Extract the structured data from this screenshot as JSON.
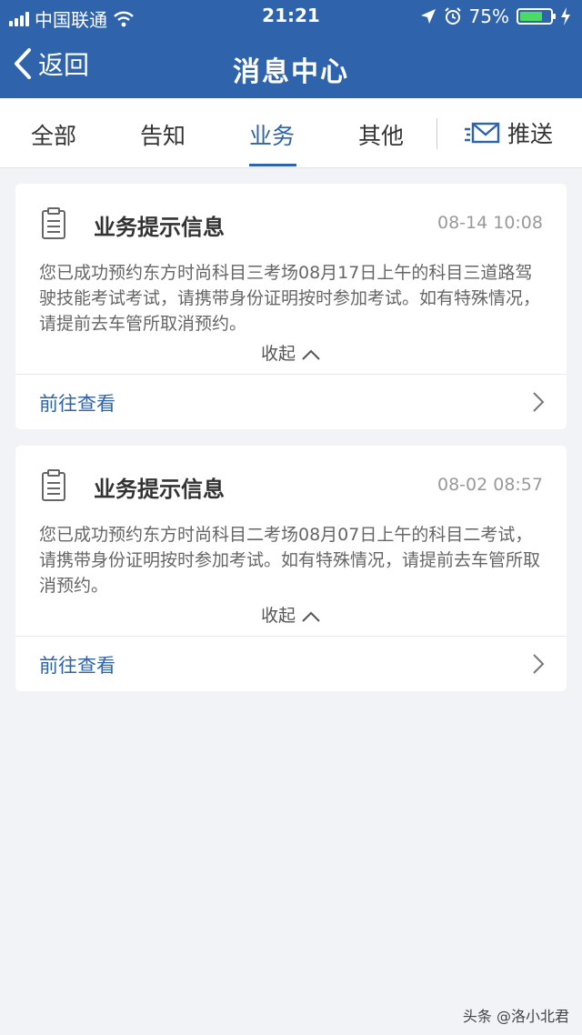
{
  "status_bar": {
    "carrier": "中国联通",
    "time": "21:21",
    "battery_percent": "75%",
    "battery_level": 0.75,
    "icons": [
      "signal-icon",
      "wifi-icon",
      "location-icon",
      "alarm-icon",
      "battery-icon",
      "charging-icon"
    ]
  },
  "nav": {
    "back_label": "返回",
    "title": "消息中心"
  },
  "tabs": [
    {
      "label": "全部"
    },
    {
      "label": "告知"
    },
    {
      "label": "业务"
    },
    {
      "label": "其他"
    }
  ],
  "active_tab": "业务",
  "push": {
    "label": "推送"
  },
  "messages": [
    {
      "title": "业务提示信息",
      "time": "08-14 10:08",
      "body": "您已成功预约东方时尚科目三考场08月17日上午的科目三道路驾驶技能考试考试，请携带身份证明按时参加考试。如有特殊情况，请提前去车管所取消预约。",
      "collapse_label": "收起",
      "link_label": "前往查看"
    },
    {
      "title": "业务提示信息",
      "time": "08-02 08:57",
      "body": "您已成功预约东方时尚科目二考场08月07日上午的科目二考试，请携带身份证明按时参加考试。如有特殊情况，请提前去车管所取消预约。",
      "collapse_label": "收起",
      "link_label": "前往查看"
    }
  ],
  "watermark": "头条 @洛小北君",
  "colors": {
    "accent": "#2f63ac",
    "background": "#f2f3f6",
    "battery_green": "#4cd964"
  }
}
